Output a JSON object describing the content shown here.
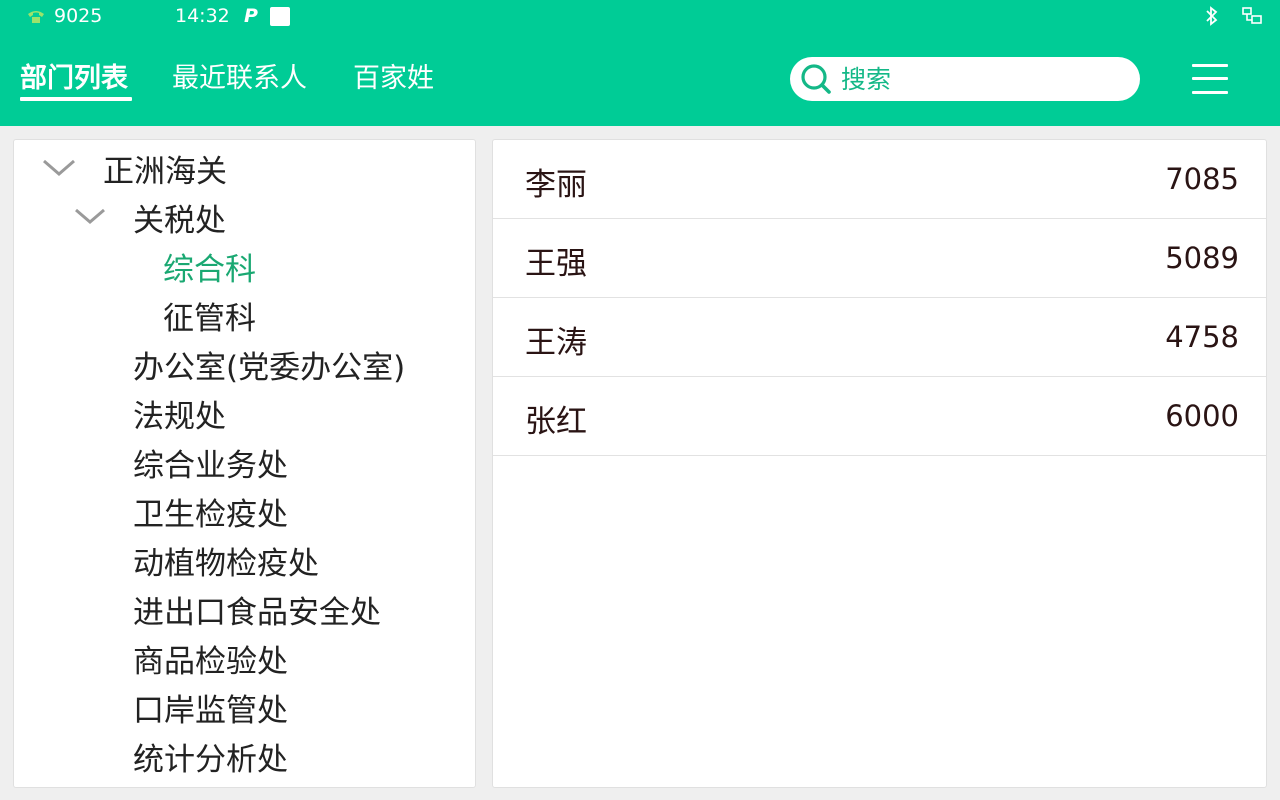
{
  "status_bar": {
    "phone_ext": "9025",
    "time": "14:32",
    "p_icon": "P"
  },
  "tabs": [
    {
      "label": "部门列表",
      "active": true
    },
    {
      "label": "最近联系人",
      "active": false
    },
    {
      "label": "百家姓",
      "active": false
    }
  ],
  "search": {
    "placeholder": "搜索",
    "value": ""
  },
  "tree": [
    {
      "label": "正洲海关",
      "level": 0,
      "expanded": true
    },
    {
      "label": "关税处",
      "level": 1,
      "expanded": true
    },
    {
      "label": "综合科",
      "level": 2,
      "selected": true
    },
    {
      "label": "征管科",
      "level": 2
    },
    {
      "label": "办公室(党委办公室)",
      "level": 1
    },
    {
      "label": "法规处",
      "level": 1
    },
    {
      "label": "综合业务处",
      "level": 1
    },
    {
      "label": "卫生检疫处",
      "level": 1
    },
    {
      "label": "动植物检疫处",
      "level": 1
    },
    {
      "label": "进出口食品安全处",
      "level": 1
    },
    {
      "label": "商品检验处",
      "level": 1
    },
    {
      "label": "口岸监管处",
      "level": 1
    },
    {
      "label": "统计分析处",
      "level": 1
    }
  ],
  "contacts": [
    {
      "name": "李丽",
      "ext": "7085"
    },
    {
      "name": "王强",
      "ext": "5089"
    },
    {
      "name": "王涛",
      "ext": "4758"
    },
    {
      "name": "张红",
      "ext": "6000"
    }
  ],
  "colors": {
    "accent": "#00cc96",
    "selected_text": "#1aa872"
  }
}
